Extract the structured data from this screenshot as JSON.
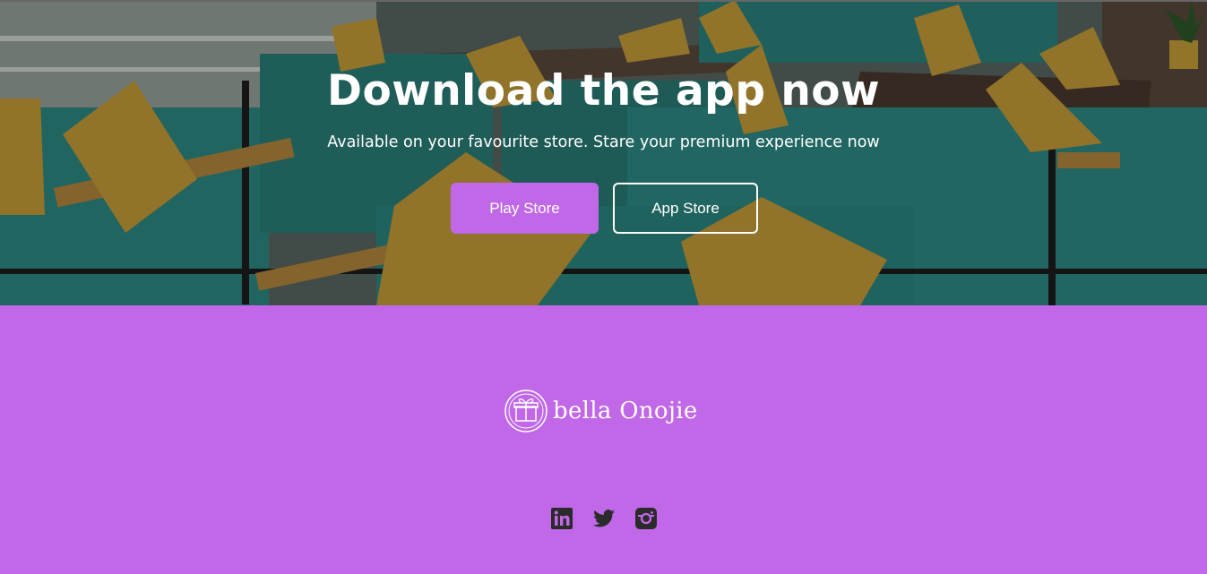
{
  "hero": {
    "title": "Download the app now",
    "subtitle": "Available on your favourite store. Stare your premium experience now",
    "play_store_label": "Play Store",
    "app_store_label": "App Store"
  },
  "footer": {
    "brand_name": "bella Onojie",
    "socials": [
      "linkedin-icon",
      "twitter-icon",
      "instagram-icon"
    ]
  },
  "colors": {
    "accent": "#c068e8",
    "text_light": "#ffffff",
    "icon_dark": "#2b2b2b"
  }
}
